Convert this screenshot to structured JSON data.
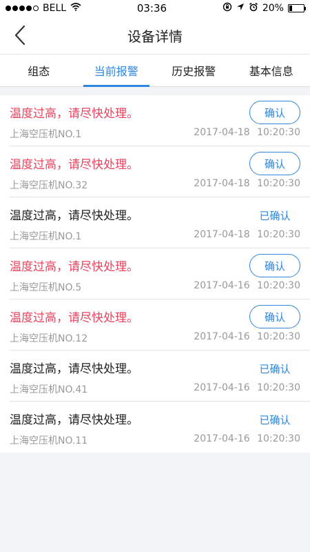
{
  "status_bar": {
    "carrier": "BELL",
    "time": "03:36",
    "battery": "20%",
    "battery_level": 0.2,
    "icons": [
      "signal-dots-icon",
      "wifi-icon",
      "rotation-lock-icon",
      "location-icon",
      "alarm-icon",
      "battery-icon"
    ]
  },
  "header": {
    "title": "设备详情",
    "back_icon": "chevron-left-icon"
  },
  "tabs": [
    {
      "label": "组态",
      "active": false
    },
    {
      "label": "当前报警",
      "active": true
    },
    {
      "label": "历史报警",
      "active": false
    },
    {
      "label": "基本信息",
      "active": false
    }
  ],
  "colors": {
    "accent": "#2e86de",
    "alarm_red": "#e8435e",
    "muted_text": "#999999"
  },
  "alarms": [
    {
      "message": "温度过高，请尽快处理。",
      "device": "上海空压机NO.1",
      "datetime": "2017-04-18 10:20:30",
      "confirmed": false,
      "action": "确认"
    },
    {
      "message": "温度过高，请尽快处理。",
      "device": "上海空压机NO.32",
      "datetime": "2017-04-18 10:20:30",
      "confirmed": false,
      "action": "确认"
    },
    {
      "message": "温度过高，请尽快处理。",
      "device": "上海空压机NO.1",
      "datetime": "2017-04-18 10:20:30",
      "confirmed": true,
      "action": "已确认"
    },
    {
      "message": "温度过高，请尽快处理。",
      "device": "上海空压机NO.5",
      "datetime": "2017-04-16 10:20:30",
      "confirmed": false,
      "action": "确认"
    },
    {
      "message": "温度过高，请尽快处理。",
      "device": "上海空压机NO.12",
      "datetime": "2017-04-16 10:20:30",
      "confirmed": false,
      "action": "确认"
    },
    {
      "message": "温度过高，请尽快处理。",
      "device": "上海空压机NO.41",
      "datetime": "2017-04-16 10:20:30",
      "confirmed": true,
      "action": "已确认"
    },
    {
      "message": "温度过高，请尽快处理。",
      "device": "上海空压机NO.11",
      "datetime": "2017-04-16 10:20:30",
      "confirmed": true,
      "action": "已确认"
    }
  ]
}
